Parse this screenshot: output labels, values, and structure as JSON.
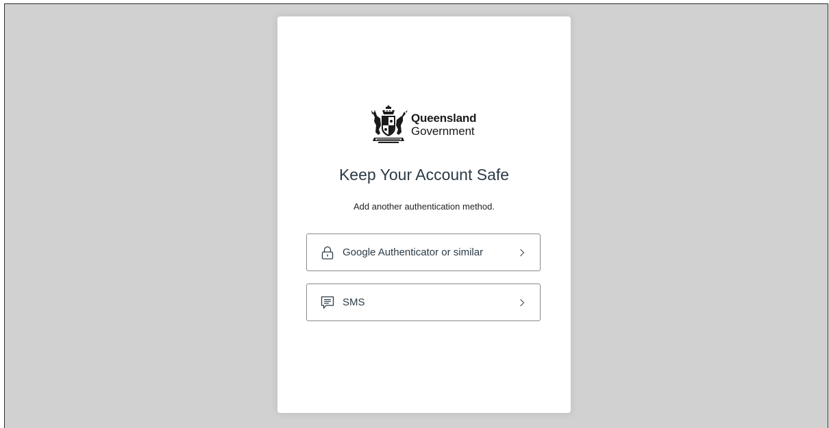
{
  "logo": {
    "line1": "Queensland",
    "line2": "Government"
  },
  "heading": "Keep Your Account Safe",
  "subheading": "Add another authentication method.",
  "options": [
    {
      "label": "Google Authenticator or similar",
      "icon": "lock-icon"
    },
    {
      "label": "SMS",
      "icon": "message-icon"
    }
  ],
  "colors": {
    "background": "#d1d1d1",
    "card": "#ffffff",
    "heading_text": "#2b3a45",
    "option_border": "#888888"
  }
}
